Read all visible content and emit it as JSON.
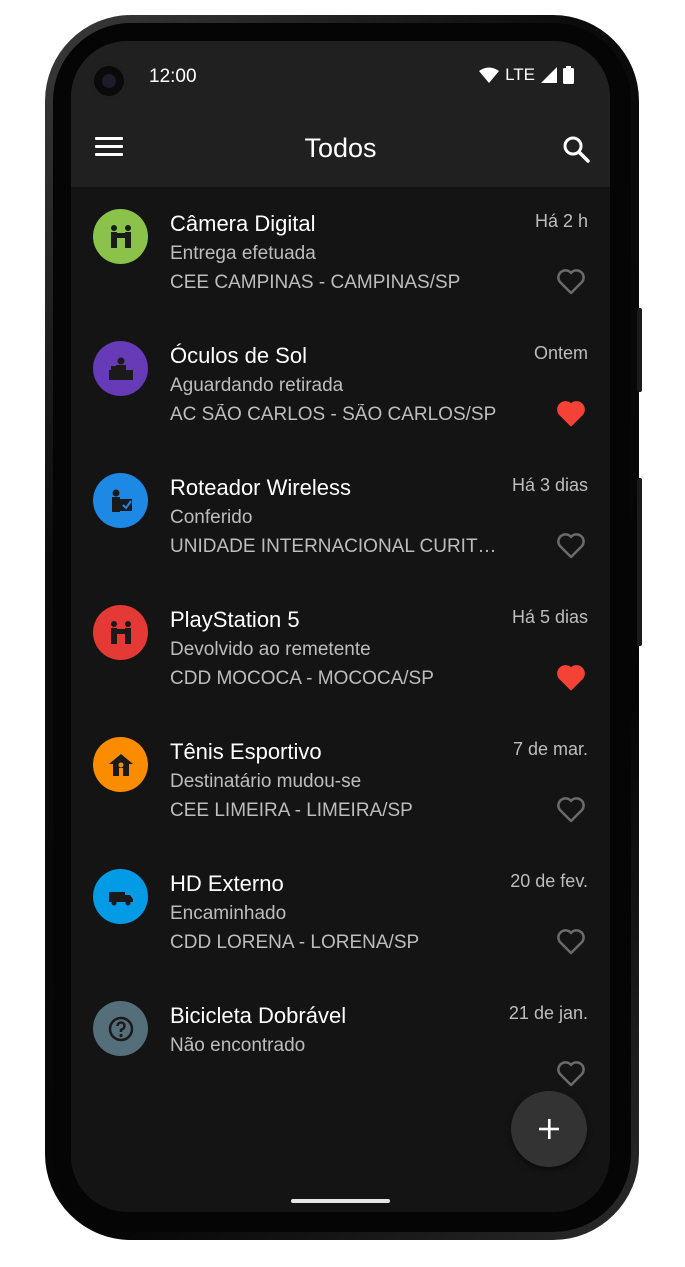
{
  "status_bar": {
    "time": "12:00",
    "network": "LTE"
  },
  "app_bar": {
    "title": "Todos",
    "menu_icon": "menu-icon",
    "search_icon": "search-icon"
  },
  "items": [
    {
      "title": "Câmera Digital",
      "status": "Entrega efetuada",
      "location": "CEE CAMPINAS - CAMPINAS/SP",
      "date": "Há 2 h",
      "favorite": false,
      "icon": "handover-icon",
      "color": "#8bc34a"
    },
    {
      "title": "Óculos de Sol",
      "status": "Aguardando retirada",
      "location": "AC SÃO CARLOS - SÃO CARLOS/SP",
      "date": "Ontem",
      "favorite": true,
      "icon": "counter-icon",
      "color": "#673ab7"
    },
    {
      "title": "Roteador Wireless",
      "status": "Conferido",
      "location": "UNIDADE INTERNACIONAL CURITIBA/PR",
      "date": "Há 3 dias",
      "favorite": false,
      "icon": "inspector-icon",
      "color": "#1e88e5"
    },
    {
      "title": "PlayStation 5",
      "status": "Devolvido ao remetente",
      "location": "CDD MOCOCA - MOCOCA/SP",
      "date": "Há 5 dias",
      "favorite": true,
      "icon": "handover-icon",
      "color": "#e53935"
    },
    {
      "title": "Tênis Esportivo",
      "status": "Destinatário mudou-se",
      "location": "CEE LIMEIRA - LIMEIRA/SP",
      "date": "7 de mar.",
      "favorite": false,
      "icon": "house-person-icon",
      "color": "#fb8c00"
    },
    {
      "title": "HD Externo",
      "status": "Encaminhado",
      "location": "CDD LORENA - LORENA/SP",
      "date": "20 de fev.",
      "favorite": false,
      "icon": "truck-icon",
      "color": "#039be5"
    },
    {
      "title": "Bicicleta Dobrável",
      "status": "Não encontrado",
      "location": "",
      "date": "21 de jan.",
      "favorite": false,
      "icon": "question-icon",
      "color": "#546e7a"
    }
  ],
  "fab": {
    "icon": "plus-icon"
  },
  "colors": {
    "background": "#141414",
    "appbar": "#202020",
    "favorite": "#f44336"
  }
}
